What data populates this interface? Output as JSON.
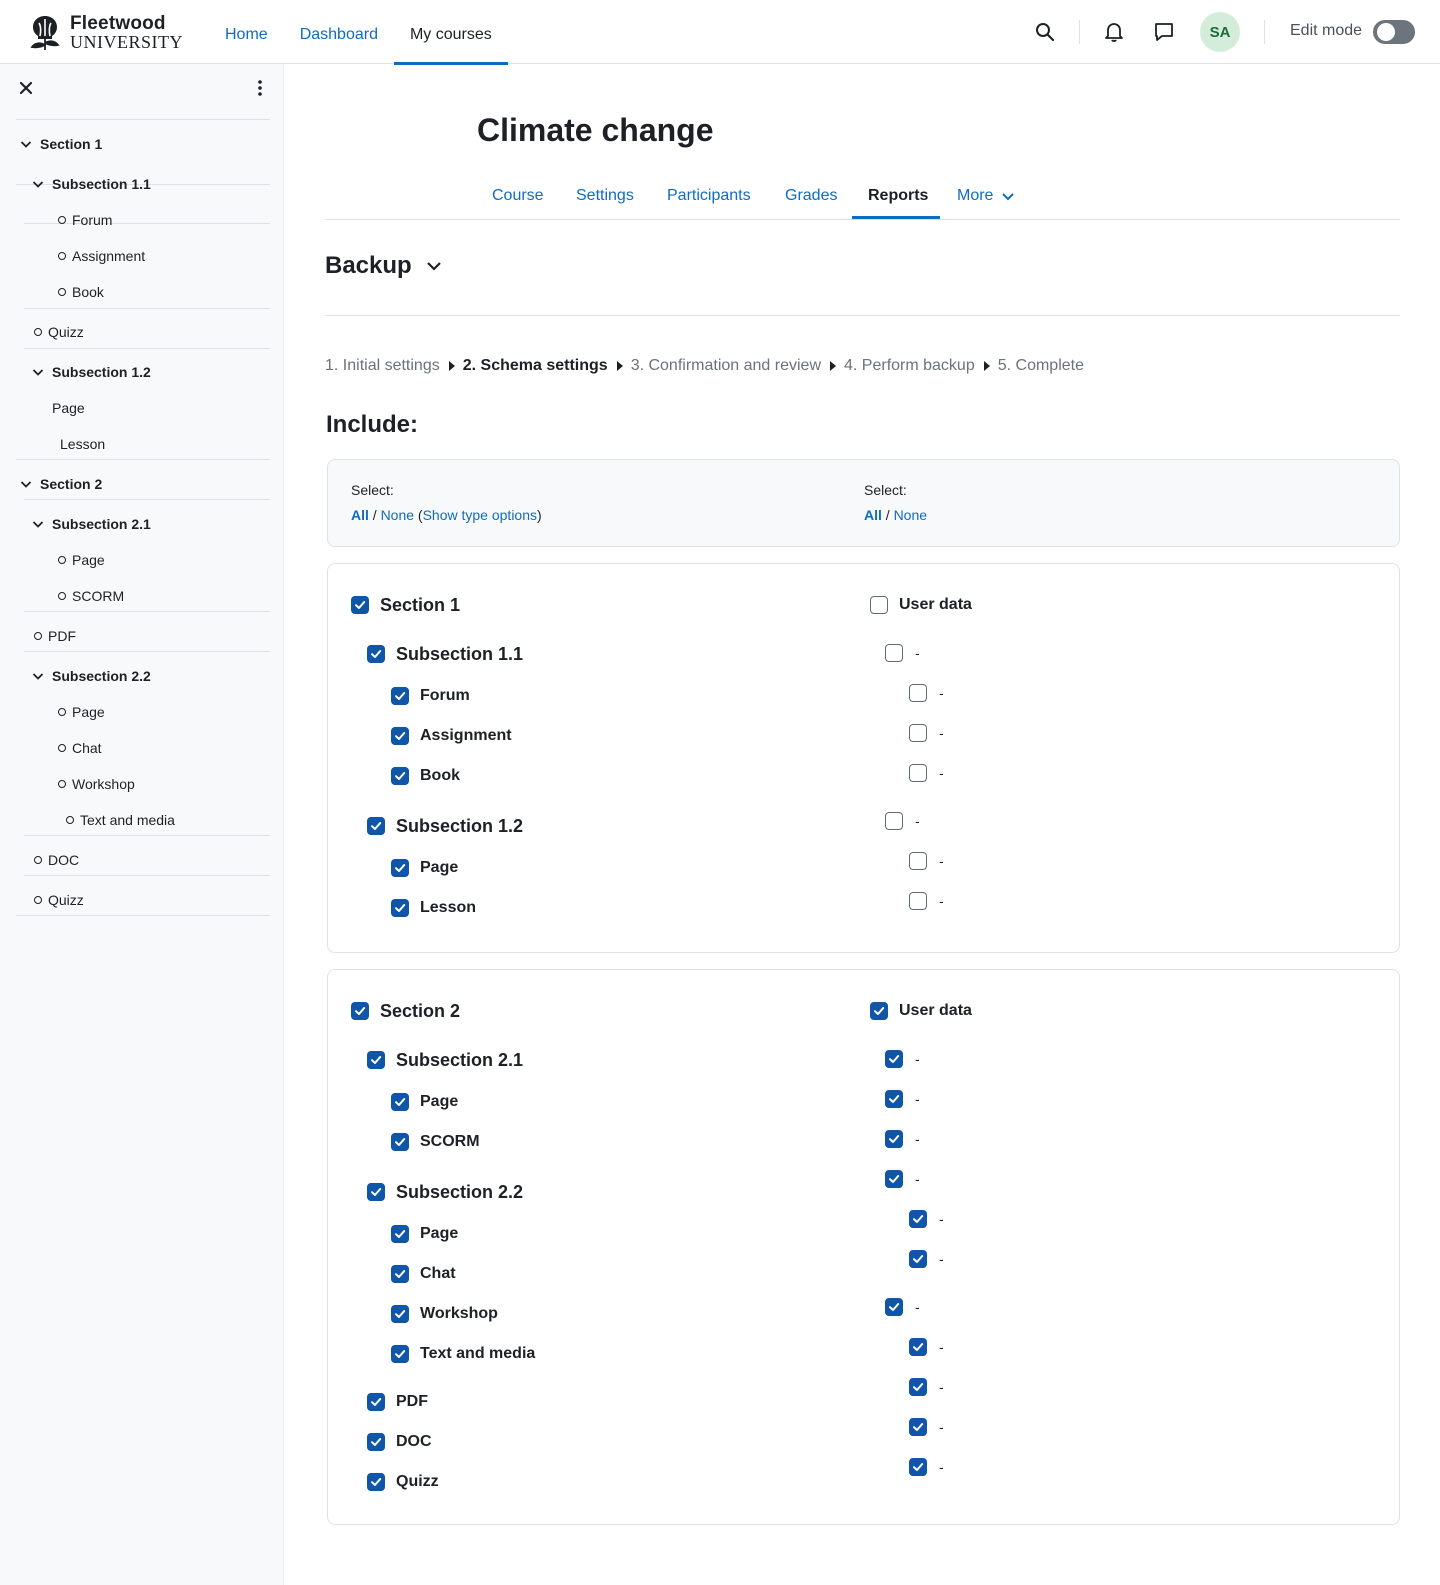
{
  "brand": {
    "name": "Fleetwood",
    "sub": "UNIVERSITY"
  },
  "nav": {
    "home": "Home",
    "dashboard": "Dashboard",
    "my_courses": "My courses"
  },
  "user": {
    "initials": "SA",
    "edit_mode": "Edit mode",
    "edit_mode_on": false
  },
  "drawer": {
    "items": [
      {
        "label": "Section 1",
        "type": "section"
      },
      {
        "label": "Subsection 1.1",
        "type": "subsection"
      },
      {
        "label": "Forum",
        "type": "activity"
      },
      {
        "label": "Assignment",
        "type": "activity"
      },
      {
        "label": "Book",
        "type": "activity"
      },
      {
        "label": "Quizz",
        "type": "activity"
      },
      {
        "label": "Subsection 1.2",
        "type": "subsection"
      },
      {
        "label": "Page",
        "type": "plain"
      },
      {
        "label": "Lesson",
        "type": "plain"
      },
      {
        "label": "Section 2",
        "type": "section"
      },
      {
        "label": "Subsection 2.1",
        "type": "subsection"
      },
      {
        "label": "Page",
        "type": "activity"
      },
      {
        "label": "SCORM",
        "type": "activity"
      },
      {
        "label": "PDF",
        "type": "activity"
      },
      {
        "label": "Subsection 2.2",
        "type": "subsection"
      },
      {
        "label": "Page",
        "type": "activity"
      },
      {
        "label": "Chat",
        "type": "activity"
      },
      {
        "label": "Workshop",
        "type": "activity"
      },
      {
        "label": "Text and media",
        "type": "activity"
      },
      {
        "label": "DOC",
        "type": "activity"
      },
      {
        "label": "Quizz",
        "type": "activity"
      }
    ]
  },
  "course": {
    "title": "Climate change"
  },
  "tabs": {
    "course": "Course",
    "settings": "Settings",
    "participants": "Participants",
    "grades": "Grades",
    "reports": "Reports",
    "more": "More"
  },
  "backup": {
    "heading": "Backup",
    "steps": [
      "1. Initial settings",
      "2. Schema settings",
      "3. Confirmation and review",
      "4. Perform backup",
      "5. Complete"
    ],
    "include_heading": "Include:",
    "select_label": "Select:",
    "all": "All",
    "none": "None",
    "slash": "/",
    "show_type_options": "Show type options",
    "paren_open": "(",
    "paren_close": ")"
  },
  "section1": {
    "title": "Section 1",
    "checked": true,
    "user_data_label": "User data",
    "user_data_checked": false,
    "rows": [
      {
        "label": "Subsection 1.1",
        "level": 1,
        "checked": true,
        "ud": false
      },
      {
        "label": "Forum",
        "level": 2,
        "checked": true,
        "ud": false
      },
      {
        "label": "Assignment",
        "level": 2,
        "checked": true,
        "ud": false
      },
      {
        "label": "Book",
        "level": 2,
        "checked": true,
        "ud": false
      },
      {
        "label": "Subsection 1.2",
        "level": 1,
        "checked": true,
        "ud": false
      },
      {
        "label": "Page",
        "level": 2,
        "checked": true,
        "ud": false
      },
      {
        "label": "Lesson",
        "level": 2,
        "checked": true,
        "ud": false
      }
    ]
  },
  "section2": {
    "title": "Section 2",
    "checked": true,
    "user_data_label": "User data",
    "user_data_checked": true,
    "rows": [
      {
        "label": "Subsection 2.1",
        "level": 1,
        "checked": true,
        "ud": true
      },
      {
        "label": "Page",
        "level": 2,
        "checked": true,
        "ud": true
      },
      {
        "label": "SCORM",
        "level": 2,
        "checked": true,
        "ud": true
      },
      {
        "label": "Subsection 2.2",
        "level": 1,
        "checked": true,
        "ud": true
      },
      {
        "label": "Page",
        "level": 2,
        "checked": true,
        "ud": true
      },
      {
        "label": "Chat",
        "level": 2,
        "checked": true,
        "ud": true
      },
      {
        "label": "Workshop",
        "level": 2,
        "checked": true,
        "ud": true
      },
      {
        "label": "Text and media",
        "level": 2,
        "checked": true,
        "ud": true
      },
      {
        "label": "PDF",
        "level": 1,
        "checked": true,
        "ud": true
      },
      {
        "label": "DOC",
        "level": 1,
        "checked": true,
        "ud": true
      },
      {
        "label": "Quizz",
        "level": 1,
        "checked": true,
        "ud": true
      }
    ]
  },
  "dash": "-",
  "colors": {
    "primary": "#0f6cbf",
    "checkbox": "#0f56a8",
    "avatar_bg": "#d4edda",
    "avatar_fg": "#1c6b3a"
  }
}
